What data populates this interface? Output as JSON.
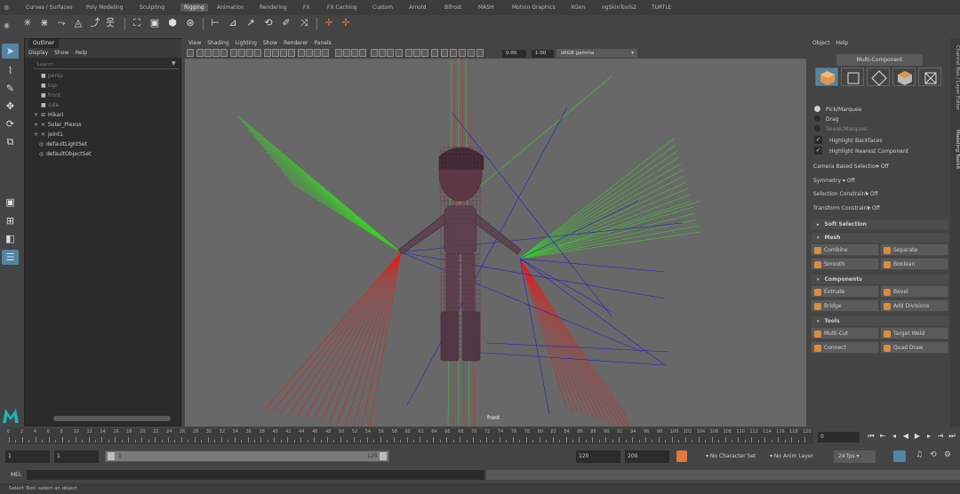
{
  "shelf": {
    "tabs": [
      "Curves / Surfaces",
      "Poly Modeling",
      "Sculpting",
      "Rigging",
      "Animation",
      "Rendering",
      "FX",
      "FX Caching",
      "Custom",
      "Arnold",
      "Bifrost",
      "MASH",
      "Motion Graphics",
      "XGen",
      "ngSkinTools2",
      "TURTLE"
    ],
    "active_tab": "Rigging"
  },
  "outliner": {
    "tab_label": "Outliner",
    "menu": [
      "Display",
      "Show",
      "Help"
    ],
    "search_placeholder": "Search...",
    "items": [
      {
        "label": "persp",
        "icon": "camera-icon",
        "dim": true
      },
      {
        "label": "top",
        "icon": "camera-icon",
        "dim": true
      },
      {
        "label": "front",
        "icon": "camera-icon",
        "dim": true
      },
      {
        "label": "side",
        "icon": "camera-icon",
        "dim": true
      },
      {
        "label": "Hikari",
        "icon": "transform-icon",
        "dim": false
      },
      {
        "label": "Solar_Plexus",
        "icon": "joint-icon",
        "dim": false
      },
      {
        "label": "joint1",
        "icon": "joint-icon",
        "dim": false
      },
      {
        "label": "defaultLightSet",
        "icon": "set-icon",
        "dim": false
      },
      {
        "label": "defaultObjectSet",
        "icon": "set-icon",
        "dim": false
      }
    ]
  },
  "viewport": {
    "menu": [
      "View",
      "Shading",
      "Lighting",
      "Show",
      "Renderer",
      "Panels"
    ],
    "field_a": "0.00",
    "field_b": "1.00",
    "colorspace": "sRGB gamma",
    "camera_label": "front"
  },
  "modeling_toolkit": {
    "menu": [
      "Object",
      "Help"
    ],
    "mode_label": "Multi-Component",
    "pick_options": [
      {
        "label": "Pick/Marquee",
        "on": true,
        "dim": false
      },
      {
        "label": "Drag",
        "on": false,
        "dim": false
      },
      {
        "label": "Tweak/Marquee",
        "on": false,
        "dim": true
      }
    ],
    "checks": [
      "Highlight Backfaces",
      "Highlight Nearest Component"
    ],
    "options": [
      {
        "label": "Camera Based Selection",
        "value": "Off"
      },
      {
        "label": "Symmetry",
        "value": "Off"
      },
      {
        "label": "Selection Constraint",
        "value": "Off"
      },
      {
        "label": "Transform Constraint",
        "value": "Off"
      }
    ],
    "sections": {
      "soft_selection": "Soft Selection",
      "mesh": "Mesh",
      "components": "Components",
      "tools": "Tools"
    },
    "mesh_buttons": [
      "Combine",
      "Separate",
      "Smooth",
      "Boolean"
    ],
    "component_buttons": [
      "Extrude",
      "Bevel",
      "Bridge",
      "Add Divisions"
    ],
    "tool_buttons": [
      "Multi-Cut",
      "Target Weld",
      "Connect",
      "Quad Draw"
    ],
    "side_tabs": [
      "Channel Box / Layer Editor",
      "Modeling Toolkit"
    ]
  },
  "timeline": {
    "ticks": [
      0,
      2,
      4,
      6,
      8,
      10,
      12,
      14,
      16,
      18,
      20,
      22,
      24,
      26,
      28,
      30,
      32,
      34,
      36,
      38,
      40,
      42,
      44,
      46,
      48,
      50,
      52,
      54,
      56,
      58,
      60,
      62,
      64,
      66,
      68,
      70,
      72,
      74,
      76,
      78,
      80,
      82,
      84,
      86,
      88,
      90,
      92,
      94,
      96,
      98,
      100,
      102,
      104,
      106,
      108,
      110,
      112,
      114,
      116,
      118,
      120
    ],
    "current_frame": "0"
  },
  "range": {
    "start": "1",
    "playback_start": "1",
    "slider_start_label": "1",
    "slider_end_label": "120",
    "playback_end": "120",
    "end": "200",
    "character_set": "No Character Set",
    "anim_layer": "No Anim Layer",
    "fps": "24 fps"
  },
  "command_line": {
    "label": "MEL"
  },
  "help_line": "Select Tool: select an object",
  "colors": {
    "accent": "#5285a6",
    "viewport_bg": "#686868",
    "red_joint": "#e0201c",
    "green_joint": "#3ccc2a",
    "blue_joint": "#2020d0"
  }
}
